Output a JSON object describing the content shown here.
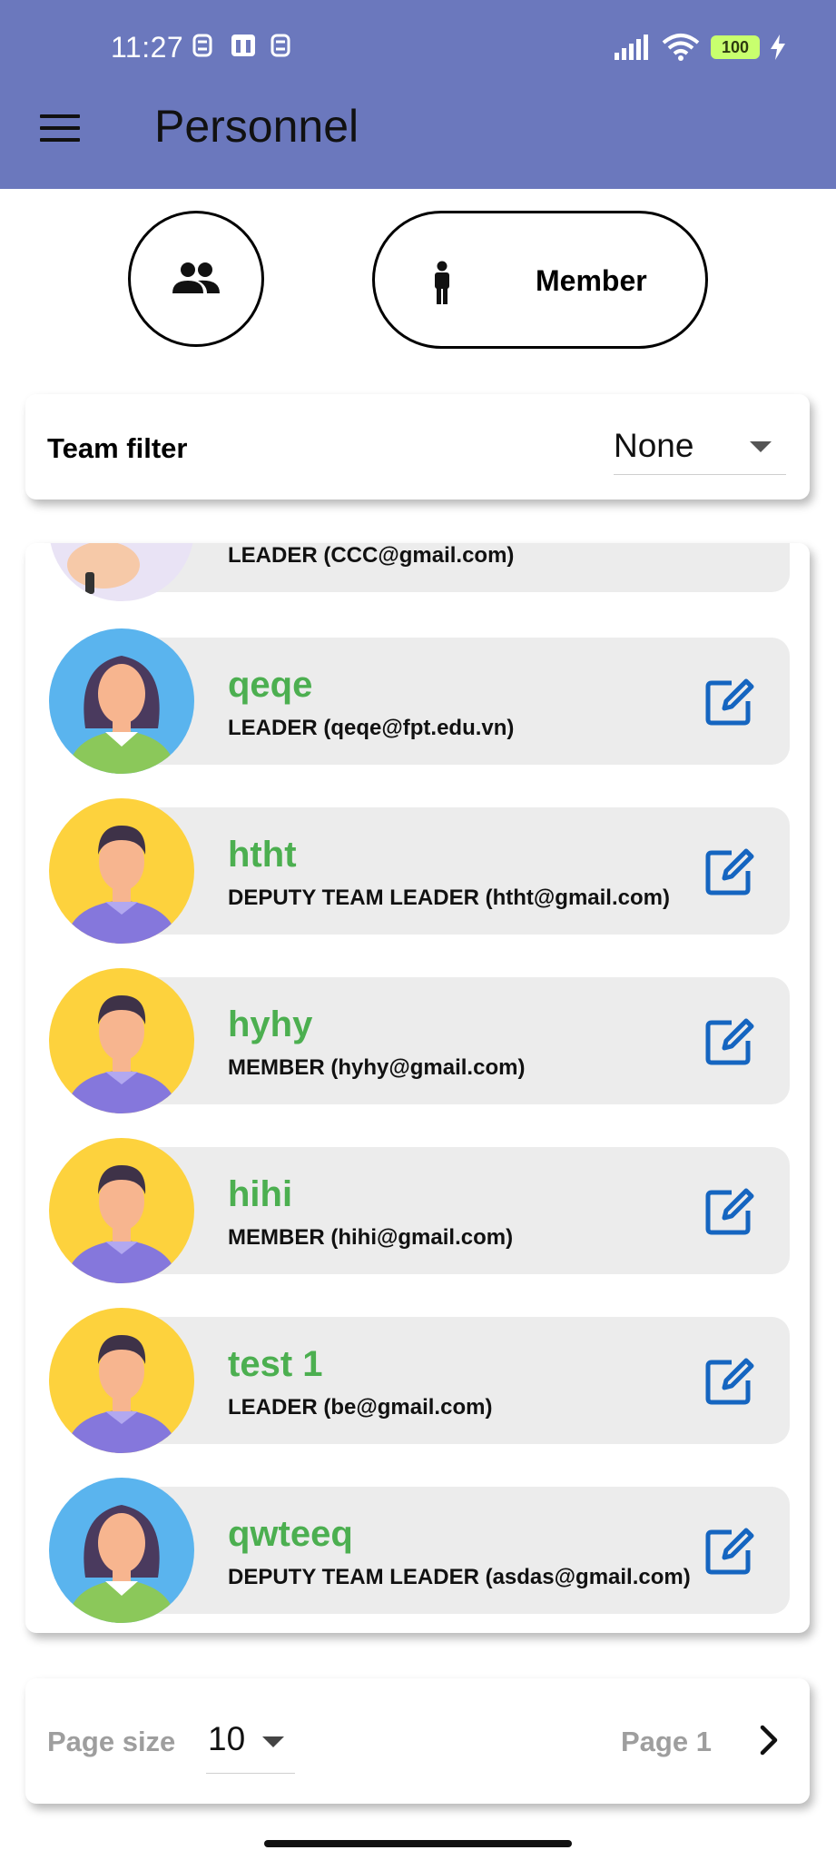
{
  "status_bar": {
    "time": "11:27",
    "battery": "100"
  },
  "app_bar": {
    "title": "Personnel"
  },
  "toggle": {
    "member_label": "Member"
  },
  "filter": {
    "label": "Team filter",
    "value": "None"
  },
  "members": [
    {
      "name": "",
      "role": "LEADER (CCC@gmail.com)",
      "avatar": "woman-blue"
    },
    {
      "name": "qeqe",
      "role": "LEADER (qeqe@fpt.edu.vn)",
      "avatar": "woman-blue"
    },
    {
      "name": "htht",
      "role": "DEPUTY TEAM LEADER (htht@gmail.com)",
      "avatar": "man-yellow"
    },
    {
      "name": "hyhy",
      "role": "MEMBER (hyhy@gmail.com)",
      "avatar": "man-yellow"
    },
    {
      "name": "hihi",
      "role": "MEMBER (hihi@gmail.com)",
      "avatar": "man-yellow"
    },
    {
      "name": "test 1",
      "role": "LEADER (be@gmail.com)",
      "avatar": "man-yellow"
    },
    {
      "name": "qwteeq",
      "role": "DEPUTY TEAM LEADER (asdas@gmail.com)",
      "avatar": "woman-blue"
    }
  ],
  "pagination": {
    "page_size_label": "Page size",
    "page_size": "10",
    "page_label": "Page 1"
  },
  "colors": {
    "app_bar": "#6b78bd",
    "name_green": "#4caf50",
    "edit_blue": "#1565c0",
    "row_bg": "#ececec"
  }
}
